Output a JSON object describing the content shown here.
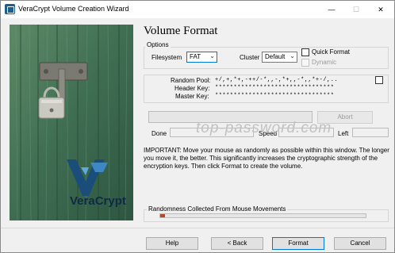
{
  "window": {
    "title": "VeraCrypt Volume Creation Wizard",
    "min_glyph": "—",
    "max_glyph": "☐",
    "close_glyph": "✕"
  },
  "side_image": {
    "logo_text": "VeraCrypt"
  },
  "page": {
    "heading": "Volume Format"
  },
  "options": {
    "group_label": "Options",
    "filesystem_label": "Filesystem",
    "filesystem_value": "FAT",
    "cluster_label": "Cluster",
    "cluster_value": "Default",
    "quick_format_label": "Quick Format",
    "quick_format_checked": false,
    "dynamic_label": "Dynamic",
    "dynamic_enabled": false
  },
  "keys": {
    "random_pool_label": "Random Pool:",
    "random_pool_value": "+/,+,*+,-++/-*,,-,*+,,-*,,*+-/,..",
    "header_key_label": "Header Key:",
    "header_key_value": "********************************",
    "master_key_label": "Master Key:",
    "master_key_value": "********************************",
    "show_keys_checked": false
  },
  "progress": {
    "abort_label": "Abort",
    "done_label": "Done",
    "speed_label": "Speed",
    "left_label": "Left",
    "fraction": 0
  },
  "watermark": "top-password.com",
  "important_text": "IMPORTANT: Move your mouse as randomly as possible within this window. The longer you move it, the better. This significantly increases the cryptographic strength of the encryption keys. Then click Format to create the volume.",
  "randomness": {
    "label": "Randomness Collected From Mouse Movements",
    "fraction": 0.02,
    "color": "#b04a28"
  },
  "buttons": {
    "help": "Help",
    "back": "< Back",
    "format": "Format",
    "cancel": "Cancel"
  },
  "colors": {
    "accent": "#0078d7"
  }
}
